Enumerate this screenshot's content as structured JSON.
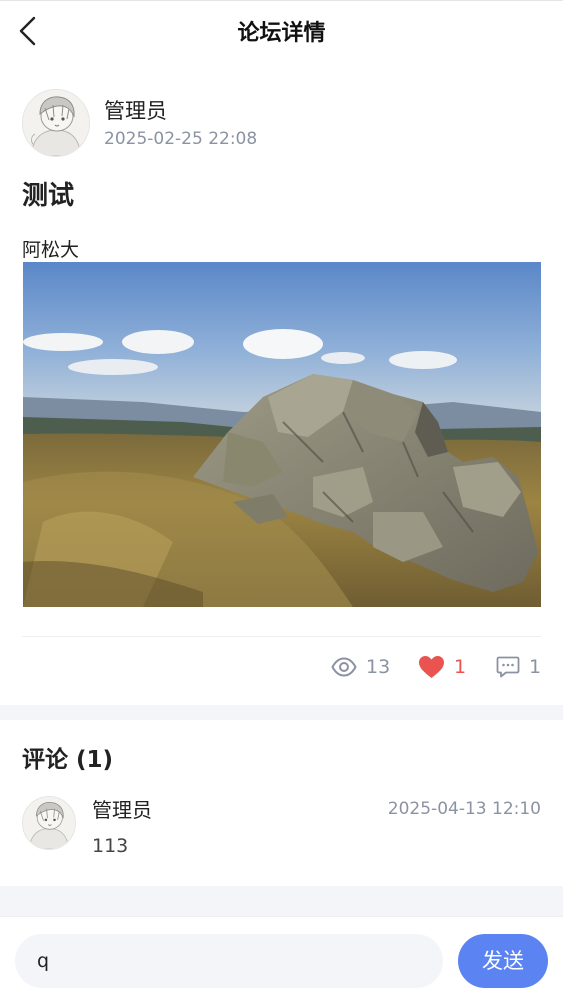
{
  "header": {
    "title": "论坛详情",
    "back_icon": "chevron-left-icon"
  },
  "post": {
    "author": "管理员",
    "time": "2025-02-25 22:08",
    "title": "测试",
    "body": "阿松大",
    "image_alt": "rocky-landscape",
    "stats": {
      "views": "13",
      "likes": "1",
      "comments": "1"
    },
    "colors": {
      "like": "#e95350",
      "meta": "#8b93a3"
    }
  },
  "comments": {
    "heading": "评论",
    "count_label": "(1)",
    "items": [
      {
        "author": "管理员",
        "time": "2025-04-13 12:10",
        "text": "113"
      }
    ]
  },
  "composer": {
    "input_value": "q",
    "send_label": "发送",
    "accent": "#5b84f2"
  }
}
